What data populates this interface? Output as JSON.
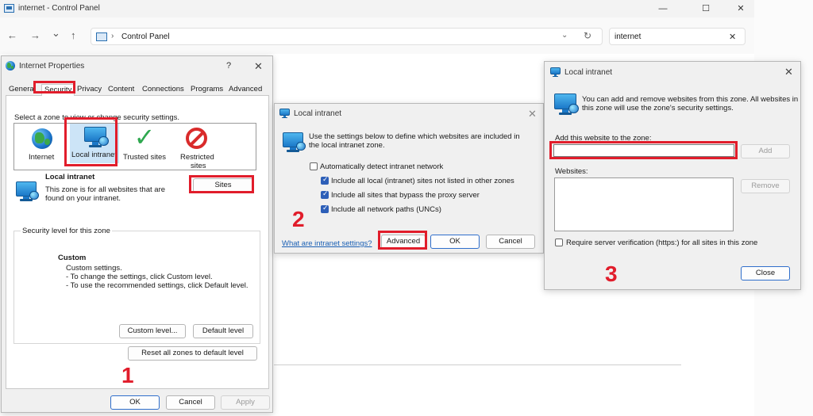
{
  "window": {
    "title": "internet - Control Panel",
    "minimize": "—",
    "maximize": "☐",
    "close": "✕"
  },
  "toolbar": {
    "back": "←",
    "forward": "→",
    "recent": "⌄",
    "up": "↑",
    "breadcrumb_sep": "›",
    "address": "Control Panel",
    "dropdown": "⌄",
    "refresh": "↻",
    "search_value": "internet",
    "search_clear": "✕"
  },
  "internet_properties": {
    "title": "Internet Properties",
    "help": "?",
    "close": "✕",
    "tabs": [
      "General",
      "Security",
      "Privacy",
      "Content",
      "Connections",
      "Programs",
      "Advanced"
    ],
    "zone_prompt": "Select a zone to view or change security settings.",
    "zones": [
      {
        "label": "Internet",
        "icon": "globe-icon"
      },
      {
        "label": "Local intranet",
        "icon": "intranet-icon"
      },
      {
        "label": "Trusted sites",
        "icon": "checkmark-icon"
      },
      {
        "label_line1": "Restricted",
        "label_line2": "sites",
        "icon": "restricted-icon"
      }
    ],
    "zone_name": "Local intranet",
    "zone_desc_line1": "This zone is for all websites that are",
    "zone_desc_line2": "found on your intranet.",
    "sites_button": "Sites",
    "security_level_legend": "Security level for this zone",
    "custom_title": "Custom",
    "custom_line1": "Custom settings.",
    "custom_line2": "- To change the settings, click Custom level.",
    "custom_line3": "- To use the recommended settings, click Default level.",
    "custom_level_button": "Custom level...",
    "default_level_button": "Default level",
    "reset_button": "Reset all zones to default level",
    "ok": "OK",
    "cancel": "Cancel",
    "apply": "Apply"
  },
  "local_intranet_1": {
    "title": "Local intranet",
    "close": "✕",
    "intro_line1": "Use the settings below to define which websites are included in",
    "intro_line2": "the local intranet zone.",
    "options": [
      {
        "label": "Automatically detect intranet network",
        "checked": false
      },
      {
        "label": "Include all local (intranet) sites not listed in other zones",
        "checked": true
      },
      {
        "label": "Include all sites that bypass the proxy server",
        "checked": true
      },
      {
        "label": "Include all network paths (UNCs)",
        "checked": true
      }
    ],
    "help_link": "What are intranet settings?",
    "advanced": "Advanced",
    "ok": "OK",
    "cancel": "Cancel"
  },
  "local_intranet_2": {
    "title": "Local intranet",
    "close": "✕",
    "intro_line1": "You can add and remove websites from this zone. All websites in",
    "intro_line2": "this zone will use the zone's security settings.",
    "add_label": "Add this website to the zone:",
    "add_value": "",
    "add_button": "Add",
    "websites_label": "Websites:",
    "remove_button": "Remove",
    "require_https": "Require server verification (https:) for all sites in this zone",
    "close_button": "Close"
  },
  "annotations": {
    "step1": "1",
    "step2": "2",
    "step3": "3",
    "color": "#e11d2b"
  }
}
